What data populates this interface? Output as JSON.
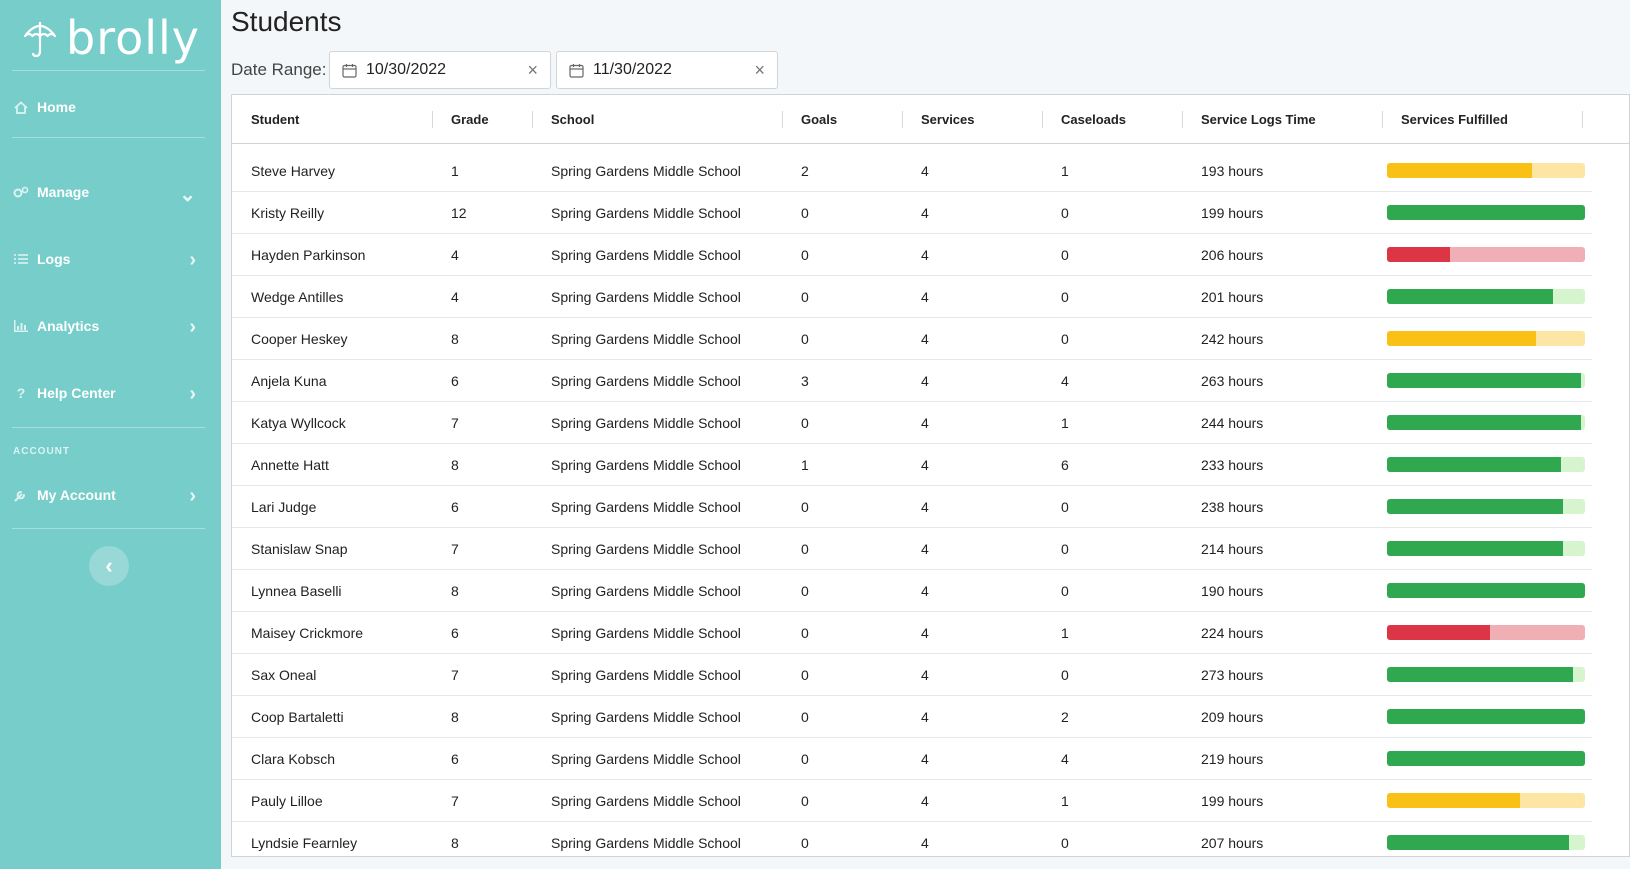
{
  "app": {
    "brand": "brolly"
  },
  "colors": {
    "sidebar_bg": "#76cdca",
    "green": "#2fa84f",
    "green_track": "#d6f5cf",
    "yellow": "#f9c015",
    "yellow_track": "#fde6a3",
    "red": "#dc3545",
    "red_track": "#f0aeb5"
  },
  "sidebar": {
    "items": [
      {
        "label": "Home",
        "icon": "home-icon"
      },
      {
        "label": "Manage",
        "icon": "gears-icon",
        "chevron": "down"
      },
      {
        "label": "Logs",
        "icon": "list-icon",
        "chevron": "right"
      },
      {
        "label": "Analytics",
        "icon": "bar-chart-icon",
        "chevron": "right"
      },
      {
        "label": "Help Center",
        "icon": "question-icon",
        "chevron": "right"
      }
    ],
    "section_label": "ACCOUNT",
    "account_item": {
      "label": "My Account",
      "icon": "wrench-icon",
      "chevron": "right"
    },
    "collapse_icon": "chevron-left-icon"
  },
  "page": {
    "title": "Students",
    "date_range_label": "Date Range:",
    "start_date": "10/30/2022",
    "end_date": "11/30/2022"
  },
  "table": {
    "columns": [
      "Student",
      "Grade",
      "School",
      "Goals",
      "Services",
      "Caseloads",
      "Service Logs Time",
      "Services Fulfilled"
    ],
    "rows": [
      {
        "student": "Steve Harvey",
        "grade": "1",
        "school": "Spring Gardens Middle School",
        "goals": "2",
        "services": "4",
        "caseloads": "1",
        "time": "193 hours",
        "fulfilled": 0.73,
        "status": "yellow"
      },
      {
        "student": "Kristy Reilly",
        "grade": "12",
        "school": "Spring Gardens Middle School",
        "goals": "0",
        "services": "4",
        "caseloads": "0",
        "time": "199 hours",
        "fulfilled": 1.0,
        "status": "green"
      },
      {
        "student": "Hayden Parkinson",
        "grade": "4",
        "school": "Spring Gardens Middle School",
        "goals": "0",
        "services": "4",
        "caseloads": "0",
        "time": "206 hours",
        "fulfilled": 0.32,
        "status": "red"
      },
      {
        "student": "Wedge Antilles",
        "grade": "4",
        "school": "Spring Gardens Middle School",
        "goals": "0",
        "services": "4",
        "caseloads": "0",
        "time": "201 hours",
        "fulfilled": 0.84,
        "status": "green"
      },
      {
        "student": "Cooper Heskey",
        "grade": "8",
        "school": "Spring Gardens Middle School",
        "goals": "0",
        "services": "4",
        "caseloads": "0",
        "time": "242 hours",
        "fulfilled": 0.75,
        "status": "yellow"
      },
      {
        "student": "Anjela Kuna",
        "grade": "6",
        "school": "Spring Gardens Middle School",
        "goals": "3",
        "services": "4",
        "caseloads": "4",
        "time": "263 hours",
        "fulfilled": 0.98,
        "status": "green"
      },
      {
        "student": "Katya Wyllcock",
        "grade": "7",
        "school": "Spring Gardens Middle School",
        "goals": "0",
        "services": "4",
        "caseloads": "1",
        "time": "244 hours",
        "fulfilled": 0.98,
        "status": "green"
      },
      {
        "student": "Annette Hatt",
        "grade": "8",
        "school": "Spring Gardens Middle School",
        "goals": "1",
        "services": "4",
        "caseloads": "6",
        "time": "233 hours",
        "fulfilled": 0.88,
        "status": "green"
      },
      {
        "student": "Lari Judge",
        "grade": "6",
        "school": "Spring Gardens Middle School",
        "goals": "0",
        "services": "4",
        "caseloads": "0",
        "time": "238 hours",
        "fulfilled": 0.89,
        "status": "green"
      },
      {
        "student": "Stanislaw Snap",
        "grade": "7",
        "school": "Spring Gardens Middle School",
        "goals": "0",
        "services": "4",
        "caseloads": "0",
        "time": "214 hours",
        "fulfilled": 0.89,
        "status": "green"
      },
      {
        "student": "Lynnea Baselli",
        "grade": "8",
        "school": "Spring Gardens Middle School",
        "goals": "0",
        "services": "4",
        "caseloads": "0",
        "time": "190 hours",
        "fulfilled": 1.0,
        "status": "green"
      },
      {
        "student": "Maisey Crickmore",
        "grade": "6",
        "school": "Spring Gardens Middle School",
        "goals": "0",
        "services": "4",
        "caseloads": "1",
        "time": "224 hours",
        "fulfilled": 0.52,
        "status": "red"
      },
      {
        "student": "Sax Oneal",
        "grade": "7",
        "school": "Spring Gardens Middle School",
        "goals": "0",
        "services": "4",
        "caseloads": "0",
        "time": "273 hours",
        "fulfilled": 0.94,
        "status": "green"
      },
      {
        "student": "Coop Bartaletti",
        "grade": "8",
        "school": "Spring Gardens Middle School",
        "goals": "0",
        "services": "4",
        "caseloads": "2",
        "time": "209 hours",
        "fulfilled": 1.0,
        "status": "green"
      },
      {
        "student": "Clara Kobsch",
        "grade": "6",
        "school": "Spring Gardens Middle School",
        "goals": "0",
        "services": "4",
        "caseloads": "4",
        "time": "219 hours",
        "fulfilled": 1.0,
        "status": "green"
      },
      {
        "student": "Pauly Lilloe",
        "grade": "7",
        "school": "Spring Gardens Middle School",
        "goals": "0",
        "services": "4",
        "caseloads": "1",
        "time": "199 hours",
        "fulfilled": 0.67,
        "status": "yellow"
      },
      {
        "student": "Lyndsie Fearnley",
        "grade": "8",
        "school": "Spring Gardens Middle School",
        "goals": "0",
        "services": "4",
        "caseloads": "0",
        "time": "207 hours",
        "fulfilled": 0.92,
        "status": "green"
      }
    ]
  }
}
